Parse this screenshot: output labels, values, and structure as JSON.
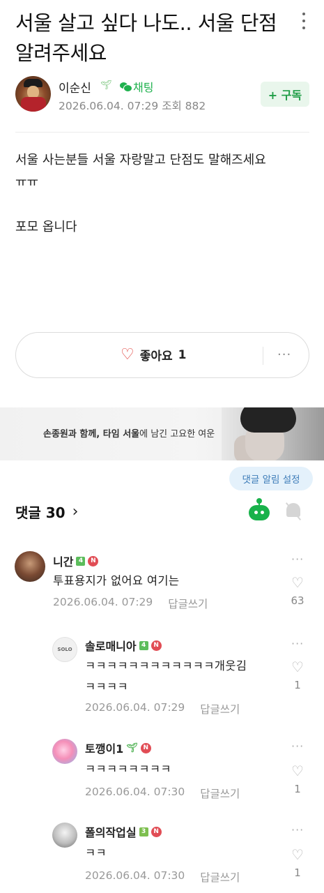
{
  "post": {
    "title": "서울 살고 싶다 나도.. 서울 단점 알려주세요",
    "author": "이순신",
    "chat_label": "채팅",
    "meta": "2026.06.04. 07:29  조회 882",
    "subscribe_label": "+ 구독",
    "body": [
      "서울 사는분들 서울 자랑말고 단점도 말해즈세요",
      "ㅠㅠ",
      "",
      "포모 옵니다"
    ],
    "like_label": "좋아요",
    "like_count": "1",
    "more": "···"
  },
  "banner": {
    "bold": "손종원과 함께, 타임 서울",
    "rest": "에 남긴 고요한 여운"
  },
  "comments_section": {
    "tooltip": "댓글 알림 설정",
    "title": "댓글 30",
    "chevron": "›",
    "items": [
      {
        "name": "니간",
        "level": "4",
        "text": [
          "투표용지가 없어요 여기는"
        ],
        "date": "2026.06.04. 07:29",
        "reply": "답글쓰기",
        "likes": "63"
      },
      {
        "name": "솔로매니아",
        "level": "4",
        "text": [
          "ㅋㅋㅋㅋㅋㅋㅋㅋㅋㅋㅋㅋ개웃김",
          "ㅋㅋㅋㅋ"
        ],
        "date": "2026.06.04. 07:29",
        "reply": "답글쓰기",
        "likes": "1"
      },
      {
        "name": "토깽이1",
        "level": "",
        "text": [
          "ㅋㅋㅋㅋㅋㅋㅋㅋ"
        ],
        "date": "2026.06.04. 07:30",
        "reply": "답글쓰기",
        "likes": "1"
      },
      {
        "name": "폴의작업실",
        "level": "3",
        "text": [
          "ㅋㅋ"
        ],
        "date": "2026.06.04. 07:30",
        "reply": "답글쓰기",
        "likes": "1"
      }
    ],
    "avatar_solo_text": "SOLO",
    "n_badge": "N",
    "kebab": "···"
  },
  "colors": {
    "accent_green": "#1fb14e",
    "like_red": "#e0403c",
    "n_badge_red": "#e14d55"
  }
}
